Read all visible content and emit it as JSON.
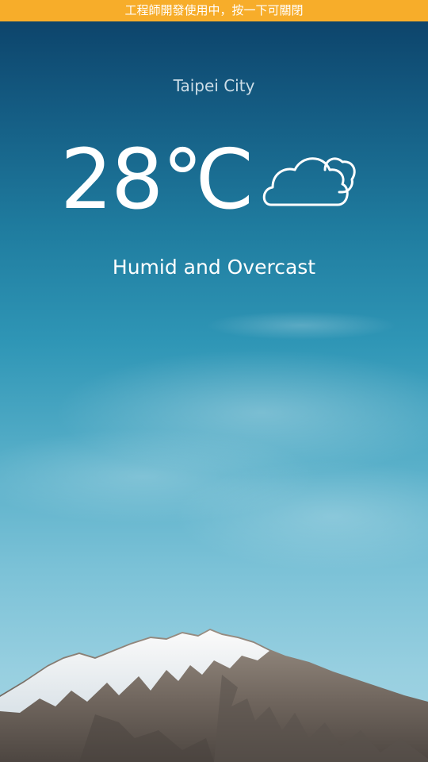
{
  "banner": {
    "text": "工程師開發使用中，按一下可關閉"
  },
  "weather": {
    "city": "Taipei City",
    "temperature": "28℃",
    "condition": "Humid and Overcast",
    "icon": "cloudy-icon"
  },
  "colors": {
    "banner_background": "#f7ad2a",
    "sky_top": "#0b3f66",
    "sky_bottom": "#a6d6e4",
    "text": "#ffffff"
  }
}
